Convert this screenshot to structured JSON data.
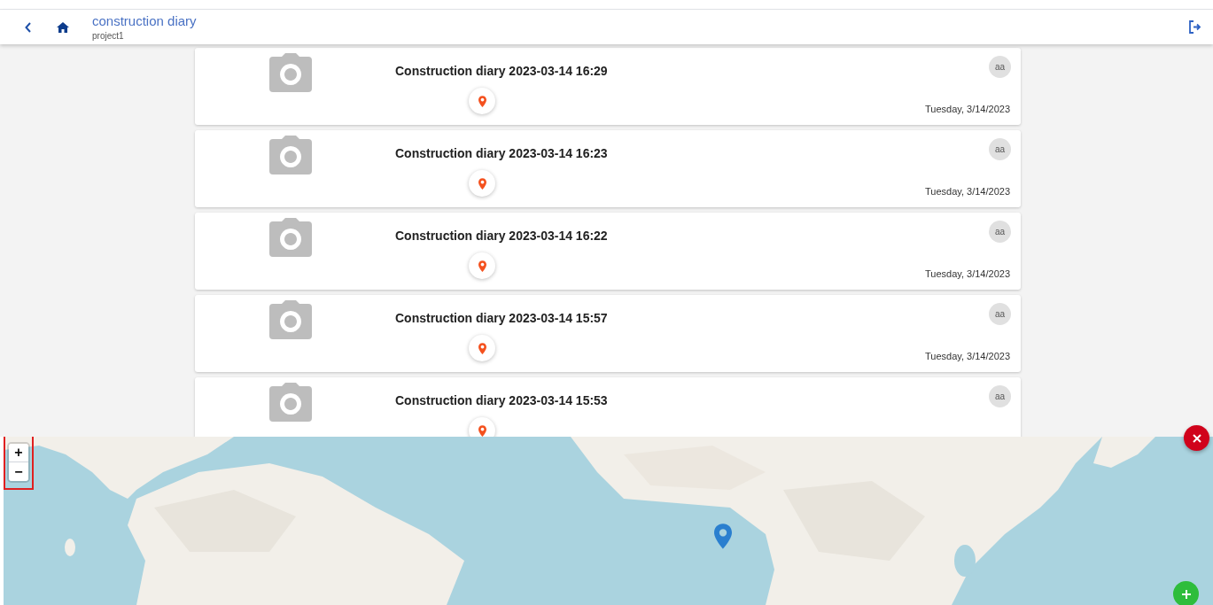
{
  "header": {
    "title": "construction diary",
    "subtitle": "project1"
  },
  "entries": [
    {
      "title": "Construction diary 2023-03-14 16:29",
      "avatar": "aa",
      "date": "Tuesday, 3/14/2023"
    },
    {
      "title": "Construction diary 2023-03-14 16:23",
      "avatar": "aa",
      "date": "Tuesday, 3/14/2023"
    },
    {
      "title": "Construction diary 2023-03-14 16:22",
      "avatar": "aa",
      "date": "Tuesday, 3/14/2023"
    },
    {
      "title": "Construction diary 2023-03-14 15:57",
      "avatar": "aa",
      "date": "Tuesday, 3/14/2023"
    },
    {
      "title": "Construction diary 2023-03-14 15:53",
      "avatar": "aa"
    }
  ],
  "map": {
    "zoom_in": "+",
    "zoom_out": "−"
  }
}
